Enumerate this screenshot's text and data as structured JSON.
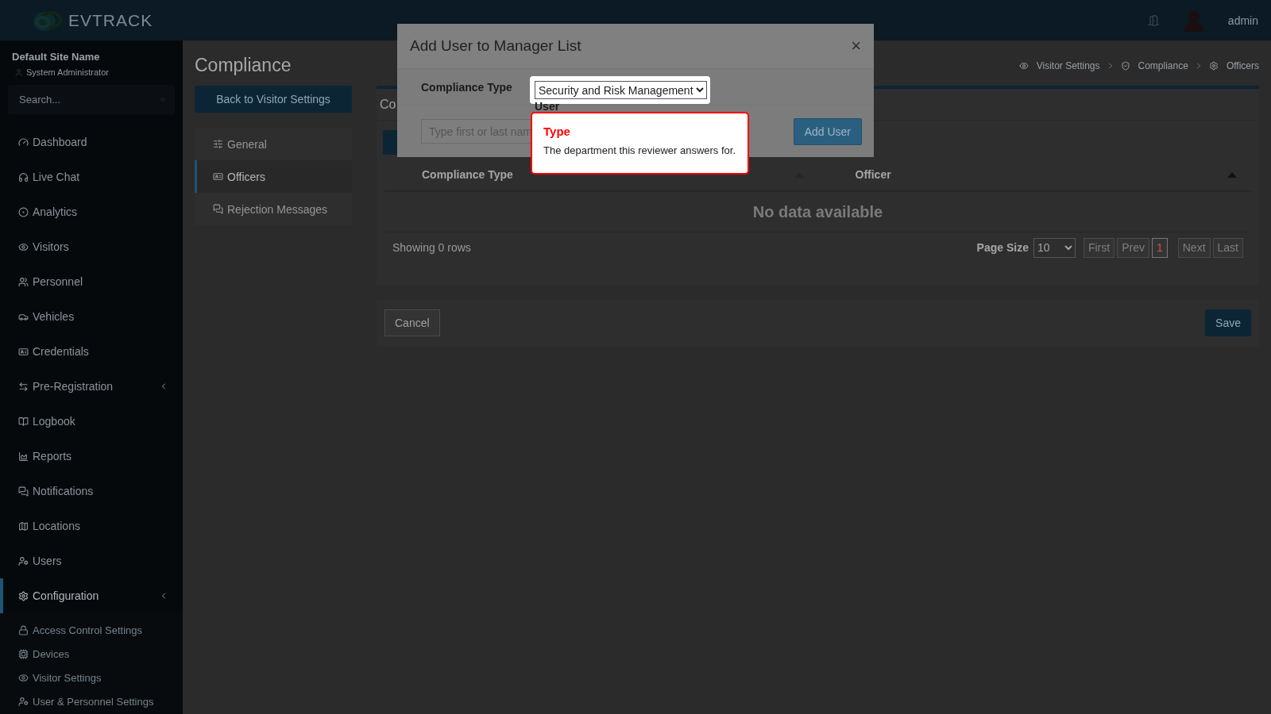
{
  "header": {
    "logo": "**EV**TRACK",
    "user": "admin"
  },
  "sidebar": {
    "site": "Default Site Name",
    "role": "System Administrator",
    "search": {
      "placeholder": "Search..."
    },
    "items": [
      {
        "label": "Dashboard",
        "selected": false
      },
      {
        "label": "Live Chat",
        "selected": false
      },
      {
        "label": "Analytics",
        "selected": false
      },
      {
        "label": "Visitors",
        "selected": false
      },
      {
        "label": "Personnel",
        "selected": false
      },
      {
        "label": "Vehicles",
        "selected": false
      },
      {
        "label": "Credentials",
        "selected": false
      },
      {
        "label": "Pre-Registration",
        "selected": false,
        "expandable": true
      },
      {
        "label": "Logbook",
        "selected": false
      },
      {
        "label": "Reports",
        "selected": false
      },
      {
        "label": "Notifications",
        "selected": false
      },
      {
        "label": "Locations",
        "selected": false
      },
      {
        "label": "Users",
        "selected": false
      },
      {
        "label": "Configuration",
        "selected": true,
        "expandable": true,
        "children": [
          {
            "label": "Access Control Settings",
            "selected": false
          },
          {
            "label": "Devices",
            "selected": false
          },
          {
            "label": "Visitor Settings",
            "selected": false
          },
          {
            "label": "User & Personnel Settings",
            "selected": false
          }
        ]
      }
    ]
  },
  "page": {
    "title": "Compliance",
    "back_button": "Back to Visitor Settings",
    "breadcrumbs": [
      "Visitor Settings",
      "Compliance",
      "Officers"
    ],
    "tabs": [
      {
        "label": "General",
        "selected": false
      },
      {
        "label": "Officers",
        "selected": true
      },
      {
        "label": "Rejection Messages",
        "selected": false
      }
    ],
    "panel": {
      "title": "Co",
      "columns": [
        "Compliance Type",
        "Officer"
      ],
      "empty": "No data available",
      "rows_text": "Showing 0 rows",
      "page_size_label": "Page Size",
      "page_size": "10",
      "pager": [
        {
          "label": "First",
          "selected": false
        },
        {
          "label": "Prev",
          "selected": false
        },
        {
          "label": "1",
          "selected": true
        },
        {
          "label": "Next",
          "selected": false
        },
        {
          "label": "Last",
          "selected": false
        }
      ]
    },
    "actions": {
      "cancel": "Cancel",
      "save": "Save"
    }
  },
  "dialog": {
    "title": "Add User to Manager List",
    "close": "×",
    "compliance_label": "Compliance Type",
    "compliance_value": "Security and Risk Management",
    "user_label": "User",
    "user_placeholder": "Type first or last nam",
    "add_button": "Add User"
  },
  "tour_tip": {
    "title": "Type",
    "text": "The department this reviewer answers for."
  }
}
